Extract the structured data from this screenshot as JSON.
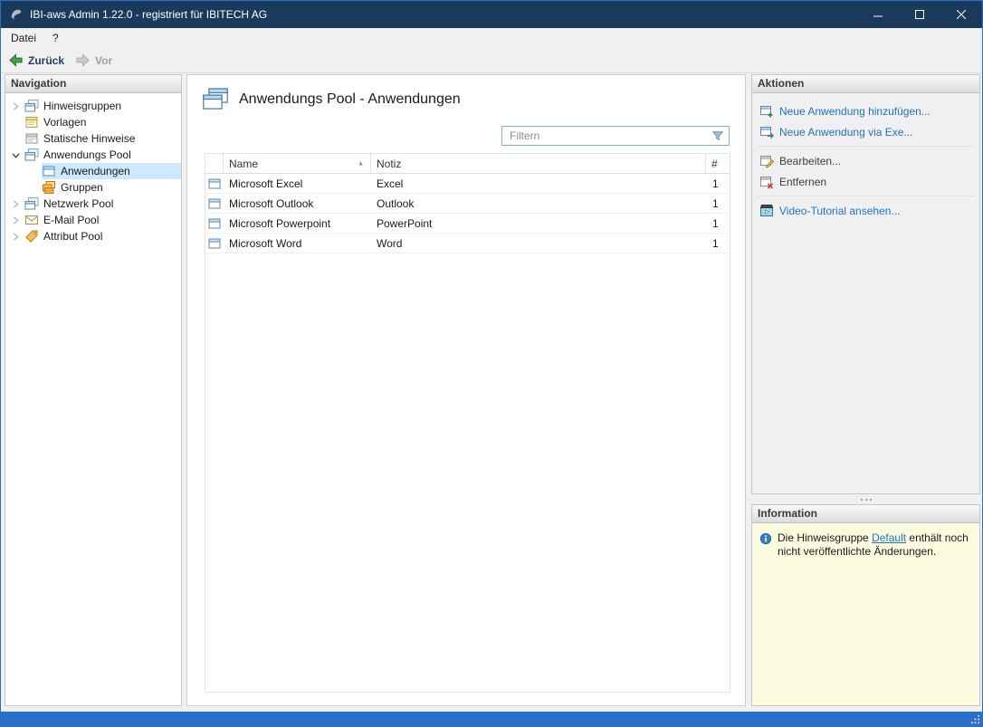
{
  "window": {
    "title": "IBI-aws Admin 1.22.0 - registriert für IBITECH AG"
  },
  "menubar": {
    "items": [
      {
        "label": "Datei"
      },
      {
        "label": "?"
      }
    ]
  },
  "toolbar": {
    "back_label": "Zurück",
    "forward_label": "Vor"
  },
  "navigation": {
    "header": "Navigation",
    "items": [
      {
        "label": "Hinweisgruppen",
        "icon": "hint-groups-icon",
        "expanded": false
      },
      {
        "label": "Vorlagen",
        "icon": "templates-icon"
      },
      {
        "label": "Statische Hinweise",
        "icon": "static-hints-icon"
      },
      {
        "label": "Anwendungs Pool",
        "icon": "application-pool-icon",
        "expanded": true
      },
      {
        "label": "Anwendungen",
        "icon": "applications-icon",
        "selected": true
      },
      {
        "label": "Gruppen",
        "icon": "groups-icon"
      },
      {
        "label": "Netzwerk Pool",
        "icon": "network-pool-icon",
        "expanded": false
      },
      {
        "label": "E-Mail Pool",
        "icon": "email-pool-icon",
        "expanded": false
      },
      {
        "label": "Attribut Pool",
        "icon": "attribute-pool-icon",
        "expanded": false
      }
    ]
  },
  "main": {
    "title": "Anwendungs Pool - Anwendungen",
    "filter_placeholder": "Filtern",
    "table": {
      "columns": {
        "name": "Name",
        "notiz": "Notiz",
        "count": "#"
      },
      "sort_indicator": "▲",
      "rows": [
        {
          "name": "Microsoft Excel",
          "notiz": "Excel",
          "count": "1"
        },
        {
          "name": "Microsoft Outlook",
          "notiz": "Outlook",
          "count": "1"
        },
        {
          "name": "Microsoft Powerpoint",
          "notiz": "PowerPoint",
          "count": "1"
        },
        {
          "name": "Microsoft Word",
          "notiz": "Word",
          "count": "1"
        }
      ]
    }
  },
  "actions": {
    "header": "Aktionen",
    "items": [
      {
        "label": "Neue Anwendung hinzufügen...",
        "style": "link"
      },
      {
        "label": "Neue Anwendung via Exe...",
        "style": "link"
      },
      {
        "label": "Bearbeiten...",
        "style": "plain"
      },
      {
        "label": "Entfernen",
        "style": "plain"
      },
      {
        "label": "Video-Tutorial ansehen...",
        "style": "link"
      }
    ]
  },
  "information": {
    "header": "Information",
    "text_before": "Die Hinweisgruppe ",
    "link_label": "Default",
    "text_after": " enthält noch nicht veröffentlichte Änderungen."
  },
  "colors": {
    "titlebar_bg": "#1a3a5c",
    "window_border": "#2a70c8",
    "statusbar_bg": "#2a70c8",
    "link": "#1e73be",
    "selected_item_bg": "#cde8ff",
    "info_panel_bg": "#fbfbdf",
    "back_arrow_green": "#43a047"
  }
}
